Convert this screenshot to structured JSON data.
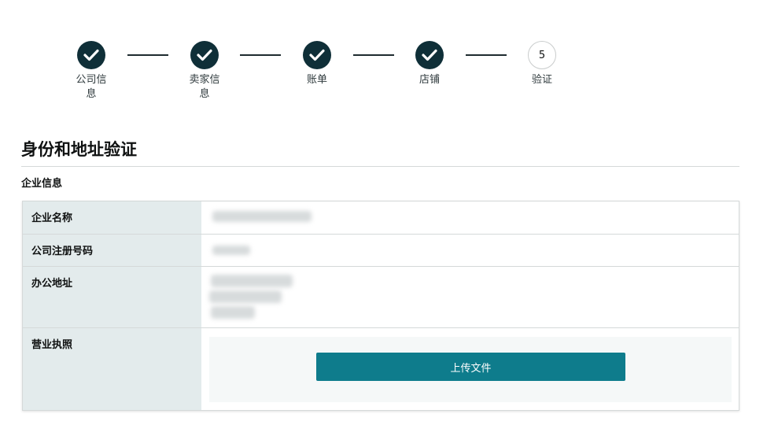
{
  "stepper": {
    "steps": [
      {
        "label": "公司信息",
        "status": "done"
      },
      {
        "label": "卖家信息",
        "status": "done"
      },
      {
        "label": "账单",
        "status": "done"
      },
      {
        "label": "店铺",
        "status": "done"
      },
      {
        "label": "验证",
        "status": "current",
        "number": "5"
      }
    ],
    "icons": {
      "done": "checkmark-icon"
    }
  },
  "page": {
    "title": "身份和地址验证",
    "section_title": "企业信息"
  },
  "table": {
    "rows": [
      {
        "label": "企业名称"
      },
      {
        "label": "公司注册号码"
      },
      {
        "label": "办公地址"
      },
      {
        "label": "营业执照",
        "upload_button": "上传文件"
      }
    ]
  },
  "colors": {
    "step_done": "#0f2f38",
    "label_bg": "#e3ebec",
    "upload_button": "#0e7c8c"
  }
}
